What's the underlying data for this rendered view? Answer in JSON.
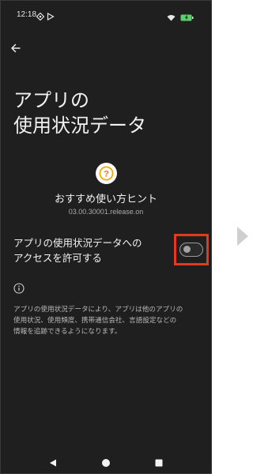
{
  "status": {
    "time": "12:18"
  },
  "header": {
    "title_line1": "アプリの",
    "title_line2": "使用状況データ"
  },
  "app": {
    "name": "おすすめ使い方ヒント",
    "version": "03.00.30001.release.on",
    "icon_glyph": "?"
  },
  "permission": {
    "label_line1": "アプリの使用状況データへの",
    "label_line2": "アクセスを許可する",
    "enabled": false
  },
  "info": {
    "description_line1": "アプリの使用状況データにより、アプリは他のアプリの",
    "description_line2": "使用状況、使用頻度、携帯通信会社、言語設定などの",
    "description_line3": "情報を追跡できるようになります。"
  },
  "colors": {
    "background": "#1f1f1f",
    "highlight": "#e5391d",
    "battery": "#5ad06a",
    "icon_accent": "#f2a900"
  }
}
